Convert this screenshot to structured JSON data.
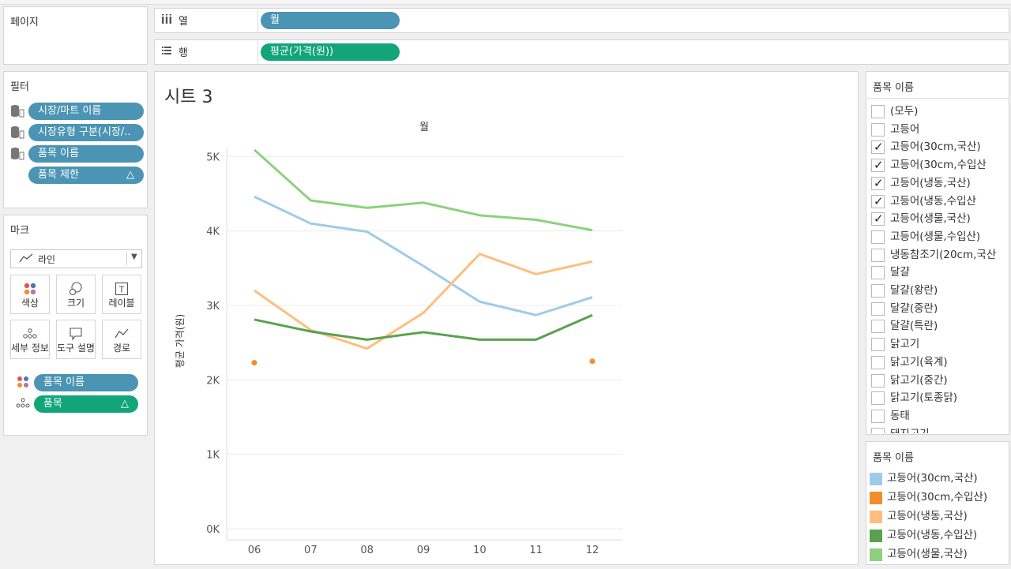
{
  "pages": {
    "title": "페이지"
  },
  "shelves": {
    "columns": {
      "label": "열",
      "pill": "월"
    },
    "rows": {
      "label": "행",
      "pill": "평균(가격(원))"
    }
  },
  "filters": {
    "title": "필터",
    "items": [
      {
        "label": "시장/마트 이름"
      },
      {
        "label": "시장유형 구분(시장/.."
      },
      {
        "label": "품목 이름"
      },
      {
        "label": "품목 제한",
        "badge": "△"
      }
    ]
  },
  "marks": {
    "title": "마크",
    "type": "라인",
    "buttons": [
      {
        "label": "색상",
        "icon": "color-dots-icon"
      },
      {
        "label": "크기",
        "icon": "size-circles-icon"
      },
      {
        "label": "레이블",
        "icon": "text-label-icon"
      },
      {
        "label": "세부 정보",
        "icon": "detail-dots-icon"
      },
      {
        "label": "도구 설명",
        "icon": "tooltip-icon"
      },
      {
        "label": "경로",
        "icon": "path-icon"
      }
    ],
    "encodings": [
      {
        "label": "품목 이름",
        "kind": "color"
      },
      {
        "label": "품목",
        "kind": "detail",
        "badge": "△"
      }
    ]
  },
  "sheet": {
    "title": "시트 3"
  },
  "filter_card": {
    "title": "품목 이름",
    "items": [
      {
        "label": "(모두)",
        "checked": false
      },
      {
        "label": "고등어",
        "checked": false
      },
      {
        "label": "고등어(30cm,국산)",
        "checked": true
      },
      {
        "label": "고등어(30cm,수입산",
        "checked": true
      },
      {
        "label": "고등어(냉동,국산)",
        "checked": true
      },
      {
        "label": "고등어(냉동,수입산",
        "checked": true
      },
      {
        "label": "고등어(생물,국산)",
        "checked": true
      },
      {
        "label": "고등어(생물,수입산)",
        "checked": false
      },
      {
        "label": "냉동참조기(20cm,국산",
        "checked": false
      },
      {
        "label": "달걀",
        "checked": false
      },
      {
        "label": "달걀(왕란)",
        "checked": false
      },
      {
        "label": "달걀(중란)",
        "checked": false
      },
      {
        "label": "달걀(특란)",
        "checked": false
      },
      {
        "label": "닭고기",
        "checked": false
      },
      {
        "label": "닭고기(육계)",
        "checked": false
      },
      {
        "label": "닭고기(중간)",
        "checked": false
      },
      {
        "label": "닭고기(토종닭)",
        "checked": false
      },
      {
        "label": "동태",
        "checked": false
      },
      {
        "label": "돼지고기",
        "checked": false
      }
    ]
  },
  "legend": {
    "title": "품목 이름",
    "items": [
      {
        "label": "고등어(30cm,국산)",
        "color": "#a0cbe8"
      },
      {
        "label": "고등어(30cm,수입산)",
        "color": "#f28e2b"
      },
      {
        "label": "고등어(냉동,국산)",
        "color": "#ffbe7d"
      },
      {
        "label": "고등어(냉동,수입산)",
        "color": "#59a14f"
      },
      {
        "label": "고등어(생물,국산)",
        "color": "#8cd17d"
      }
    ]
  },
  "chart_data": {
    "type": "line",
    "title": "월",
    "xlabel": "",
    "ylabel": "평균 가격(원)",
    "categories": [
      "06",
      "07",
      "08",
      "09",
      "10",
      "11",
      "12"
    ],
    "y_ticks": [
      "0K",
      "1K",
      "2K",
      "3K",
      "4K",
      "5K"
    ],
    "ylim": [
      0,
      5300
    ],
    "grid": true,
    "series": [
      {
        "name": "고등어(30cm,국산)",
        "color": "#a0cbe8",
        "values": [
          4460,
          4100,
          3990,
          3530,
          3050,
          2870,
          3110
        ]
      },
      {
        "name": "고등어(30cm,수입산)",
        "color": "#f28e2b",
        "values": [
          2230,
          null,
          null,
          null,
          null,
          null,
          2250
        ]
      },
      {
        "name": "고등어(냉동,국산)",
        "color": "#ffbe7d",
        "values": [
          3200,
          2670,
          2420,
          2900,
          3690,
          3420,
          3590
        ]
      },
      {
        "name": "고등어(냉동,수입산)",
        "color": "#59a14f",
        "values": [
          2810,
          2650,
          2540,
          2640,
          2540,
          2540,
          2870
        ]
      },
      {
        "name": "고등어(생물,국산)",
        "color": "#8cd17d",
        "values": [
          5090,
          4410,
          4310,
          4380,
          4210,
          4150,
          4010
        ]
      }
    ]
  }
}
